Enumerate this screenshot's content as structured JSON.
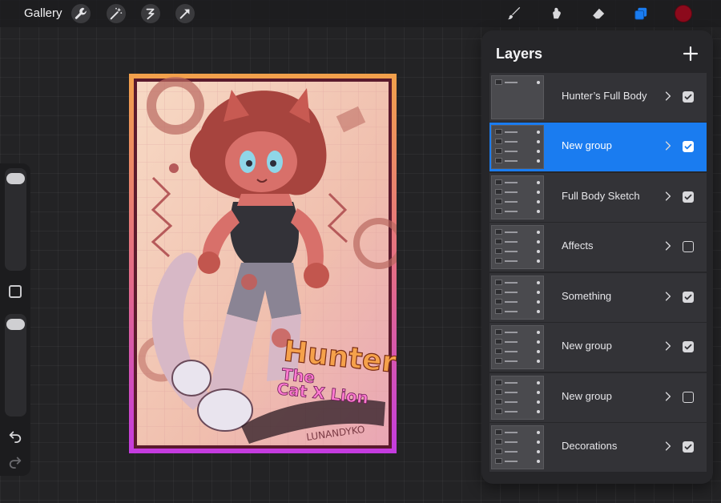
{
  "toolbar": {
    "gallery_label": "Gallery",
    "left_tools": [
      "wrench-icon",
      "magic-wand-icon",
      "selection-icon",
      "transform-arrow-icon"
    ],
    "right_tools": [
      "brush-icon",
      "smudge-icon",
      "eraser-icon",
      "layers-icon"
    ],
    "active_color": "#8c0a1c",
    "accent_color": "#1a7cf0"
  },
  "sidebar": {
    "brush_size_level": 0.92,
    "opacity_level": 0.92,
    "undo_icon": "undo-icon",
    "redo_icon": "redo-icon"
  },
  "artwork": {
    "title_line1": "Hunter",
    "title_line2": "The",
    "title_line3": "Cat X Lion",
    "signature": "LUNANDYKO"
  },
  "layers": {
    "title": "Layers",
    "add_icon": "plus-icon",
    "items": [
      {
        "name": "Hunter’s Full Body",
        "visible": true,
        "selected": false
      },
      {
        "name": "New group",
        "visible": true,
        "selected": true
      },
      {
        "name": "Full Body Sketch",
        "visible": true,
        "selected": false
      },
      {
        "name": "Affects",
        "visible": false,
        "selected": false
      },
      {
        "name": "Something",
        "visible": true,
        "selected": false
      },
      {
        "name": "New group",
        "visible": true,
        "selected": false
      },
      {
        "name": "New group",
        "visible": false,
        "selected": false
      },
      {
        "name": "Decorations",
        "visible": true,
        "selected": false
      }
    ]
  }
}
